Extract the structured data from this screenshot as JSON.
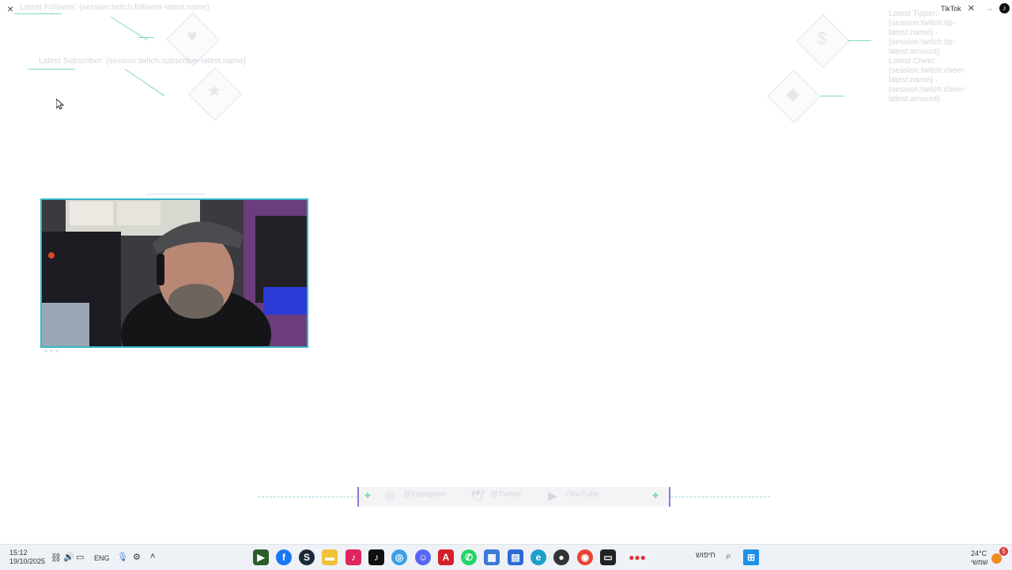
{
  "overlay": {
    "latest_follower": "Latest Follower: {session:twitch:follower-latest:name}",
    "latest_subscriber": "Latest Subscriber: {session:twitch:subscriber-latest:name}",
    "latest_tipper": "Latest Tipper:",
    "tip_lines": [
      "{session:twitch:tip-",
      "latest:name} -",
      "{session:twitch:tip-",
      "latest:amount}"
    ],
    "latest_cheer": "Latest Cheer:",
    "cheer_lines": [
      "{session:twitch:cheer-",
      "latest:name} -",
      "{session:twitch:cheer-",
      "latest:amount}"
    ],
    "icons": {
      "heart": "heart-icon",
      "star": "star-icon",
      "dollar": "dollar-icon",
      "diamond": "diamond-icon"
    }
  },
  "window": {
    "left_close": "×",
    "title": "TikTok",
    "close": "×",
    "forward": "→"
  },
  "social": {
    "instagram": "@instagram",
    "twitter": "@Twitter",
    "youtube": "/YouTube"
  },
  "taskbar": {
    "time": "15:12",
    "date": "19/10/2025",
    "lang": "ENG",
    "search_placeholder": "חיפוש",
    "weather_temp": "24°C",
    "weather_desc": "שמשי",
    "notification_count": "5"
  },
  "colors": {
    "accent_teal": "#35b6c7",
    "accent_green": "#7fd9b6",
    "accent_purple": "#8d7ad6"
  }
}
